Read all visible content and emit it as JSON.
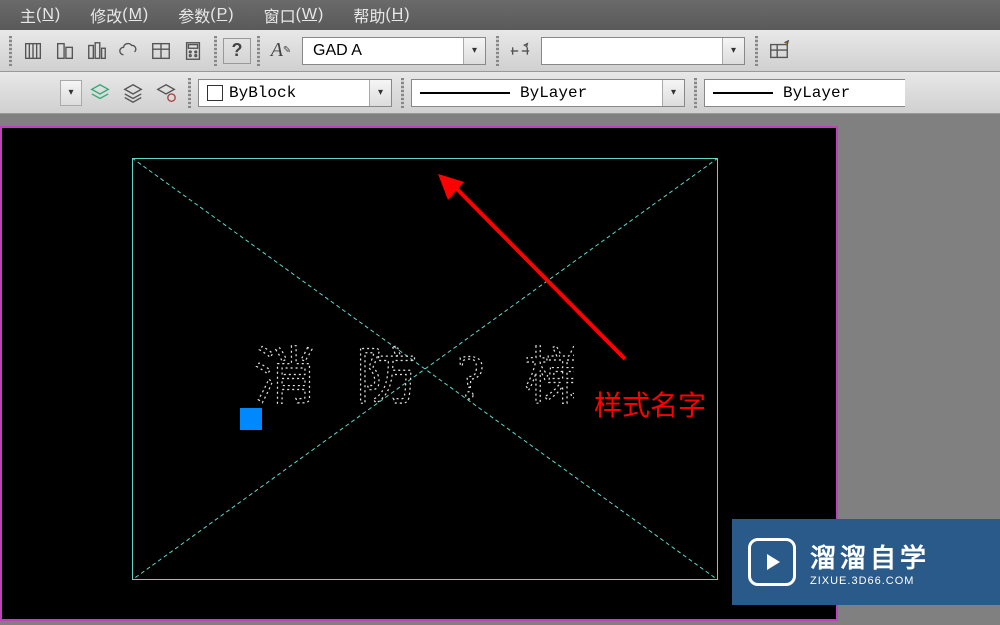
{
  "menubar": {
    "items": [
      {
        "label": "主",
        "key": "N"
      },
      {
        "label": "修改",
        "key": "M"
      },
      {
        "label": "参数",
        "key": "P"
      },
      {
        "label": "窗口",
        "key": "W"
      },
      {
        "label": "帮助",
        "key": "H"
      }
    ]
  },
  "toolbar": {
    "style_value": "GAD A",
    "byblock": "ByBlock",
    "bylayer1": "ByLayer",
    "bylayer2": "ByLayer"
  },
  "annotation": {
    "label": "样式名字"
  },
  "canvas": {
    "text_content": "消 防 ? 梯"
  },
  "watermark": {
    "title": "溜溜自学",
    "subtitle": "ZIXUE.3D66.COM"
  },
  "colors": {
    "magenta_border": "#c040c0",
    "cyan_selection": "#5dd8c8",
    "grip_blue": "#0088ff",
    "anno_red": "#ff0000",
    "wm_bg": "#2a5a8a"
  }
}
